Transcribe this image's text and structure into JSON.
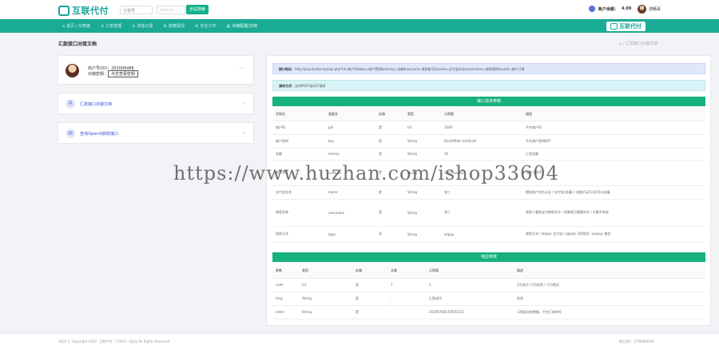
{
  "header": {
    "brand": "互联代付",
    "search_select": "订单号",
    "search_placeholder": "Search...",
    "search_button": "全站搜索",
    "account_label": "账户余额：",
    "account_amount": "4.00",
    "username": "流畅哥"
  },
  "nav": {
    "items": [
      {
        "icon": "⌂",
        "label": "首页 / 仪表盘"
      },
      {
        "icon": "≡",
        "label": "订单管理"
      },
      {
        "icon": "≡",
        "label": "资金记录"
      },
      {
        "icon": "⚙",
        "label": "结算提现"
      },
      {
        "icon": "⚙",
        "label": "安全工作"
      },
      {
        "icon": "▤",
        "label": "对接配置/文档"
      }
    ],
    "brand": "互联代付"
  },
  "page": {
    "title": "汇款接口对接文档",
    "breadcrumb": "⌂ / 汇款接口对接文档"
  },
  "merchant": {
    "id_label": "商户号(ID)：",
    "id_value": "202006486",
    "key_label": "对接密钥：",
    "key_button": "点击查看密钥",
    "more": "···"
  },
  "links": [
    {
      "icon": "🗎",
      "label": "汇款接口对接文档",
      "color": "#3a4fd8"
    },
    {
      "icon": "✉",
      "label": "查询OpenId获取接口",
      "color": "#3a4fd8"
    }
  ],
  "api": {
    "url_label": "接口地址：",
    "url_value": "http://pay.duotip.top/api.php?id=商户ID&key=商户密钥&money=金额&account=收款账号&name=支付宝实名&username=商家昵称&outid=商户订单",
    "method_label": "请求方式：",
    "method_value": "支持POST或GET请求",
    "request_title": "接口请求参数",
    "request_headers": [
      "字段名",
      "变量名",
      "必填",
      "类型",
      "示例值",
      "描述"
    ],
    "request_rows": [
      [
        "商户ID",
        "pid",
        "是",
        "Int",
        "1000",
        "平台商户ID"
      ],
      [
        "商户密钥",
        "key",
        "是",
        "String",
        "Dec0f6b9r..b2d2cbh",
        "平台商户密钥KEY"
      ],
      [
        "金额",
        "money",
        "是",
        "String",
        "10",
        "汇款金额"
      ],
      [
        "收款账号",
        "account",
        "是",
        "String",
        "1867xxxxxx",
        "收款人账号"
      ],
      [
        "支付宝实名",
        "name",
        "是",
        "String",
        "张三",
        "提现账户实名认证 / 支付宝(选填) / 金额不足0元时可以选填"
      ],
      [
        "商家名称",
        "username",
        "是",
        "String",
        "张三",
        "收款人看到支付转账名字 / 如果提示需要实名 / 可能不有效"
      ],
      [
        "收款方式",
        "type",
        "否",
        "String",
        "alipay",
        "收款方式 / alipay: 支付宝 / qqpay: QQ钱包 / wxpay: 微信"
      ]
    ],
    "response_title": "响应参数",
    "response_headers": [
      "参数",
      "类型",
      "必填",
      "长度",
      "示例值",
      "描述"
    ],
    "response_rows": [
      [
        "code",
        "Int",
        "是",
        "1",
        "1",
        "1为成功 / 0为失败 / -1为错误"
      ],
      [
        "msg",
        "String",
        "是",
        "-",
        "汇款成功",
        "信息"
      ],
      [
        "order",
        "String",
        "是",
        "-",
        "20200706145925312",
        "示例返回的数据，平台汇款单号"
      ]
    ]
  },
  "watermark": "https://www.huzhan.com/ishop33604",
  "footer": {
    "left": "2020 © Copyright 2020 · 互联代付 · 7.0013 · Kpay All Rights Reserved",
    "right": "售后QQ：1798899654"
  }
}
